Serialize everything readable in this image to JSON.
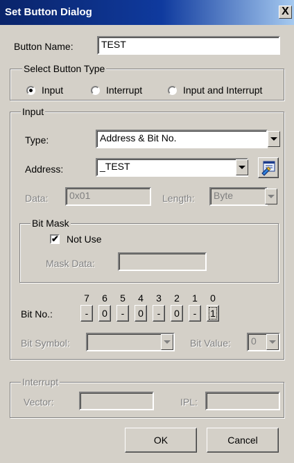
{
  "window": {
    "title": "Set Button Dialog",
    "close_glyph": "X"
  },
  "button_name": {
    "label": "Button Name:",
    "value": "TEST"
  },
  "button_type": {
    "title": "Select Button Type",
    "options": [
      {
        "label": "Input",
        "selected": true
      },
      {
        "label": "Interrupt",
        "selected": false
      },
      {
        "label": "Input and Interrupt",
        "selected": false
      }
    ]
  },
  "input": {
    "title": "Input",
    "type_label": "Type:",
    "type_value": "Address & Bit No.",
    "address_label": "Address:",
    "address_value": "_TEST",
    "data_label": "Data:",
    "data_value": "0x01",
    "length_label": "Length:",
    "length_value": "Byte",
    "bitmask": {
      "title": "Bit Mask",
      "not_use_label": "Not Use",
      "not_use_checked": true,
      "mask_data_label": "Mask Data:",
      "mask_data_value": ""
    },
    "bitno": {
      "label": "Bit No.:",
      "numbers": [
        "7",
        "6",
        "5",
        "4",
        "3",
        "2",
        "1",
        "0"
      ],
      "cells": [
        "-",
        "0",
        "-",
        "0",
        "-",
        "0",
        "-",
        "1"
      ]
    },
    "bit_symbol_label": "Bit Symbol:",
    "bit_symbol_value": "",
    "bit_value_label": "Bit Value:",
    "bit_value_value": "0"
  },
  "interrupt": {
    "title": "Interrupt",
    "vector_label": "Vector:",
    "vector_value": "",
    "ipl_label": "IPL:",
    "ipl_value": ""
  },
  "buttons": {
    "ok": "OK",
    "cancel": "Cancel"
  },
  "icons": {
    "address_browse": "browse-icon",
    "check": "✔"
  }
}
